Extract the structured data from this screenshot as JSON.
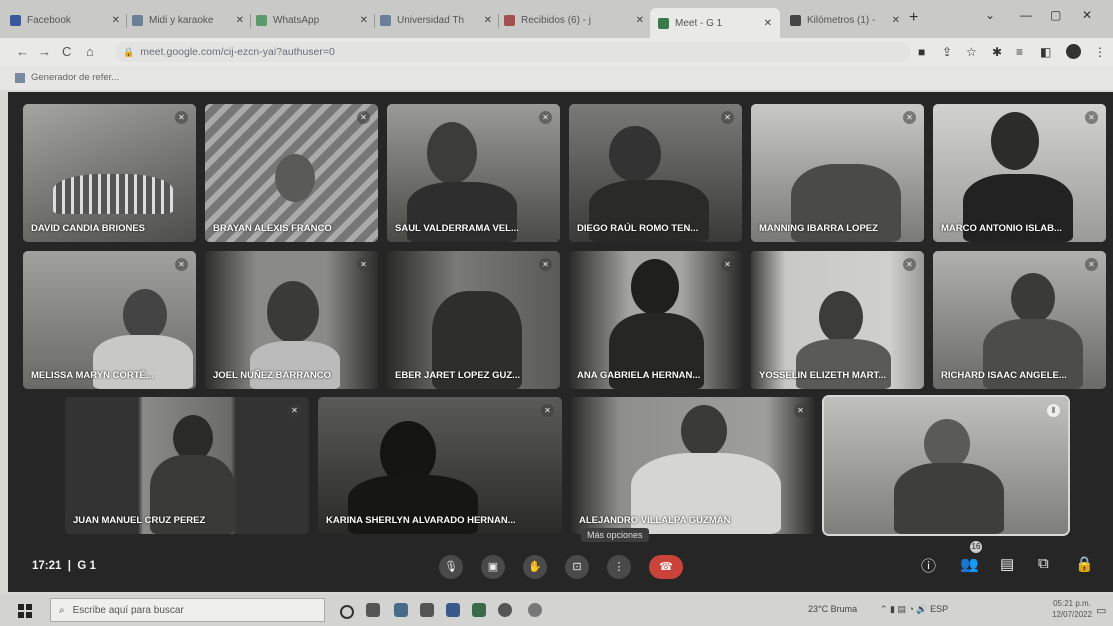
{
  "browser": {
    "tabs": [
      {
        "label": "Facebook"
      },
      {
        "label": "Midi y karaoke"
      },
      {
        "label": "WhatsApp"
      },
      {
        "label": "Universidad Th"
      },
      {
        "label": "Recibidos (6) - j"
      },
      {
        "label": "Meet - G 1"
      },
      {
        "label": "Kilómetros (1) -"
      }
    ],
    "address": "meet.google.com/cij-ezcn-yai?authuser=0",
    "bookmark": "Generador de refer..."
  },
  "meet": {
    "participants": [
      {
        "name": "DAVID CANDIA BRIONES"
      },
      {
        "name": "BRAYAN ALEXIS FRANCO"
      },
      {
        "name": "SAUL VALDERRAMA VEL..."
      },
      {
        "name": "DIEGO RAÚL ROMO TEN..."
      },
      {
        "name": "MANNING IBARRA LOPEZ"
      },
      {
        "name": "MARCO ANTONIO ISLAB..."
      },
      {
        "name": "MELISSA MARYN CORTÉ..."
      },
      {
        "name": "JOEL NUÑEZ BARRANCO"
      },
      {
        "name": "EBER JARET LOPEZ GUZ..."
      },
      {
        "name": "ANA GABRIELA HERNAN..."
      },
      {
        "name": "YOSSELIN ELIZETH MART..."
      },
      {
        "name": "RICHARD ISAAC ANGELE..."
      },
      {
        "name": "JUAN MANUEL CRUZ PEREZ"
      },
      {
        "name": "KARINA SHERLYN ALVARADO HERNAN..."
      },
      {
        "name": "ALEJANDRO VILLALPA GUZMÁN"
      },
      {
        "name": ""
      }
    ],
    "time": "17:21",
    "meeting_name": "G 1",
    "tooltip": "Más opciones",
    "people_count": "16"
  },
  "taskbar": {
    "search_placeholder": "Escribe aquí para buscar",
    "weather": "23°C Bruma",
    "clock_time": "05:21 p.m.",
    "clock_date": "12/07/2022"
  }
}
